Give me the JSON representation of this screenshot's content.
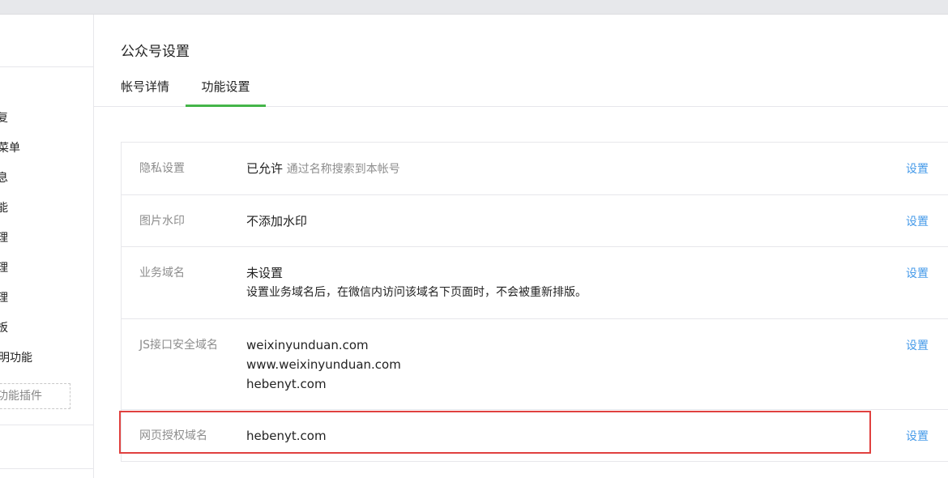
{
  "page": {
    "title": "公众号设置"
  },
  "tabs": [
    {
      "label": "帐号详情",
      "active": false
    },
    {
      "label": "功能设置",
      "active": true
    }
  ],
  "sidebar": {
    "items": [
      "复",
      "菜单",
      "息",
      "能",
      "理",
      "理",
      "理",
      "板",
      "明功能"
    ],
    "plugin_button": "功能插件"
  },
  "settings": {
    "rows": [
      {
        "label": "隐私设置",
        "value": "已允许",
        "value_note": "通过名称搜索到本帐号",
        "action": "设置"
      },
      {
        "label": "图片水印",
        "value": "不添加水印",
        "action": "设置"
      },
      {
        "label": "业务域名",
        "value": "未设置",
        "value_desc": "设置业务域名后，在微信内访问该域名下页面时，不会被重新排版。",
        "action": "设置"
      },
      {
        "label": "JS接口安全域名",
        "values": [
          "weixinyunduan.com",
          "www.weixinyunduan.com",
          "hebenyt.com"
        ],
        "action": "设置"
      },
      {
        "label": "网页授权域名",
        "value": "hebenyt.com",
        "action": "设置"
      }
    ]
  },
  "colors": {
    "accent_green": "#44b549",
    "link_blue": "#459ae9",
    "highlight_red": "#e0413f"
  }
}
